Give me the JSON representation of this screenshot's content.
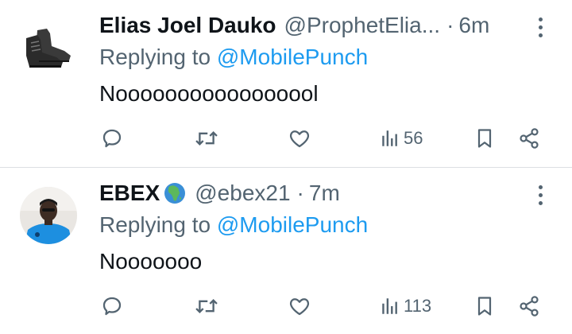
{
  "colors": {
    "text": "#0f1419",
    "secondary": "#536471",
    "link": "#1d9bf0",
    "divider": "#dcdfe3"
  },
  "tweets": [
    {
      "author": {
        "display_name": "Elias Joel Dauko",
        "handle": "@ProphetElia...",
        "avatar": "boots-photo",
        "emoji": null
      },
      "dot": "·",
      "time": "6m",
      "reply_prefix": "Replying to",
      "reply_to": "@MobilePunch",
      "text": "Nooooooooooooooool",
      "views": "56",
      "icons": [
        "reply-icon",
        "retweet-icon",
        "like-icon",
        "views-icon",
        "bookmark-icon",
        "share-icon",
        "more-icon"
      ]
    },
    {
      "author": {
        "display_name": "EBEX",
        "handle": "@ebex21",
        "avatar": "person-photo",
        "emoji": "globe-africa-icon"
      },
      "dot": "·",
      "time": "7m",
      "reply_prefix": "Replying to",
      "reply_to": "@MobilePunch",
      "text": "Nooooooo",
      "views": "113",
      "icons": [
        "reply-icon",
        "retweet-icon",
        "like-icon",
        "views-icon",
        "bookmark-icon",
        "share-icon",
        "more-icon"
      ]
    }
  ]
}
